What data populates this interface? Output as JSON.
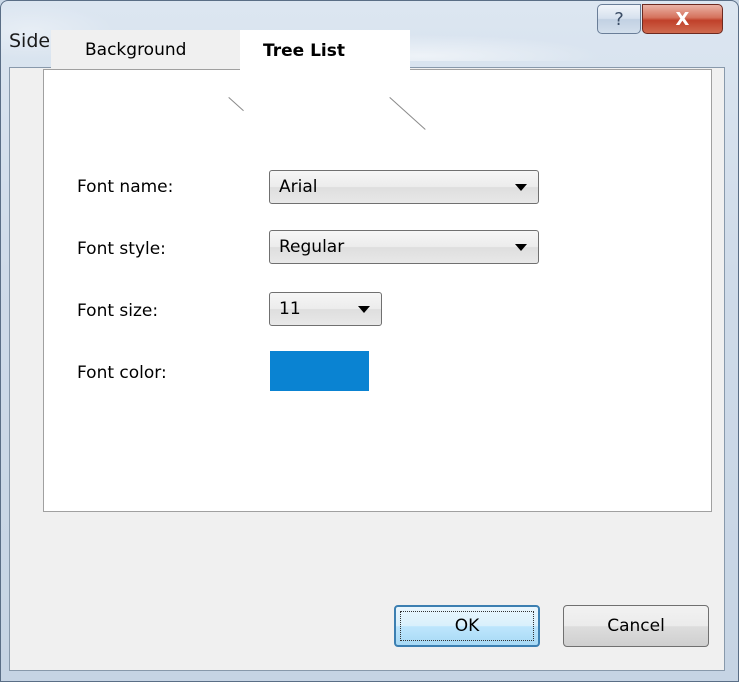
{
  "window": {
    "title": "Side Bar Properties",
    "help_glyph": "?",
    "close_glyph": "X"
  },
  "tabs": {
    "background_label": "Background",
    "tree_list_label": "Tree List",
    "selected": "Tree List"
  },
  "form": {
    "font_name_label": "Font name:",
    "font_name_value": "Arial",
    "font_style_label": "Font style:",
    "font_style_value": "Regular",
    "font_size_label": "Font size:",
    "font_size_value": "11",
    "font_color_label": "Font color:",
    "font_color_value": "#0a83d2"
  },
  "buttons": {
    "ok_label": "OK",
    "cancel_label": "Cancel"
  },
  "colors": {
    "accent_ok_border": "#3c7fb1",
    "close_button": "#c0402a"
  },
  "icons": {
    "help": "help-icon",
    "close": "close-icon",
    "dropdown": "chevron-down-icon"
  }
}
